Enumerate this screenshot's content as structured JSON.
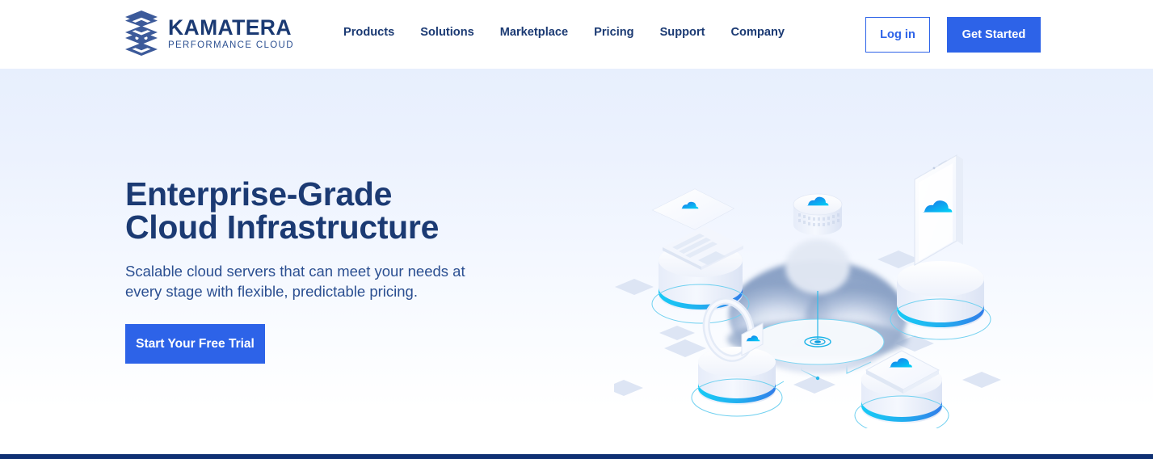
{
  "header": {
    "brand": {
      "logo_icon": "kamatera-stacked-hexagon-logo",
      "name": "KAMATERA",
      "tagline": "PERFORMANCE  CLOUD"
    },
    "nav_items": [
      {
        "label": "Products"
      },
      {
        "label": "Solutions"
      },
      {
        "label": "Marketplace"
      },
      {
        "label": "Pricing"
      },
      {
        "label": "Support"
      },
      {
        "label": "Company"
      }
    ],
    "login_label": "Log in",
    "get_started_label": "Get Started"
  },
  "hero": {
    "title": "Enterprise-Grade Cloud Infrastructure",
    "subtitle": "Scalable cloud servers that can meet your needs at every stage with flexible, predictable pricing.",
    "cta_label": "Start Your Free Trial",
    "illustration": "isometric-cloud-infrastructure-devices"
  },
  "colors": {
    "brand_navy": "#1b3a73",
    "accent_blue": "#2d63e8",
    "cyan_accent": "#00c6f5",
    "hero_gradient_top": "#e7effd",
    "hero_gradient_bottom": "#ffffff",
    "footer_bar": "#0f3073",
    "body_text": "#2b4f91"
  }
}
